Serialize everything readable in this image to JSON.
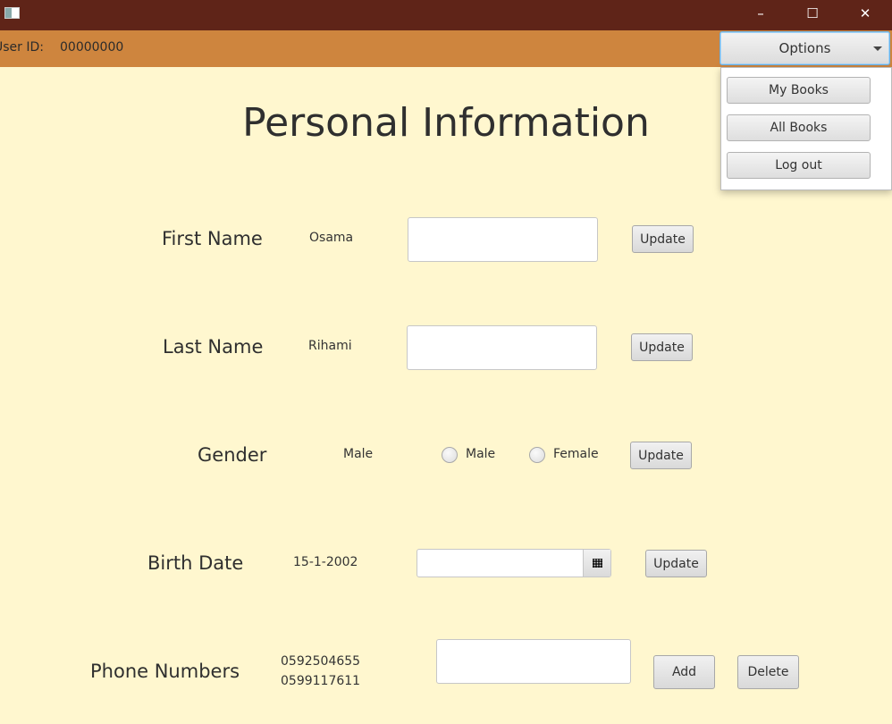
{
  "window": {
    "controls": {
      "minimize": "–",
      "maximize": "☐",
      "close": "✕"
    },
    "colors": {
      "titlebar": "#5F2418",
      "header": "#CE853E",
      "background": "#FFF7CF"
    }
  },
  "header": {
    "user_id_label": "User ID:",
    "user_id_value": "00000000",
    "options_label": "Options"
  },
  "dropdown": {
    "items": [
      "My Books",
      "All Books",
      "Log out"
    ]
  },
  "main": {
    "title": "Personal Information",
    "first_name": {
      "label": "First Name",
      "value": "Osama",
      "input_value": "",
      "button": "Update"
    },
    "last_name": {
      "label": "Last Name",
      "value": "Rihami",
      "input_value": "",
      "button": "Update"
    },
    "gender": {
      "label": "Gender",
      "value": "Male",
      "options": [
        "Male",
        "Female"
      ],
      "button": "Update"
    },
    "birth_date": {
      "label": "Birth Date",
      "value": "15-1-2002",
      "input_value": "",
      "icon": "calendar-icon",
      "button": "Update"
    },
    "phone_numbers": {
      "label": "Phone Numbers",
      "values": [
        "0592504655",
        "0599117611"
      ],
      "input_value": "",
      "add_button": "Add",
      "delete_button": "Delete"
    }
  }
}
